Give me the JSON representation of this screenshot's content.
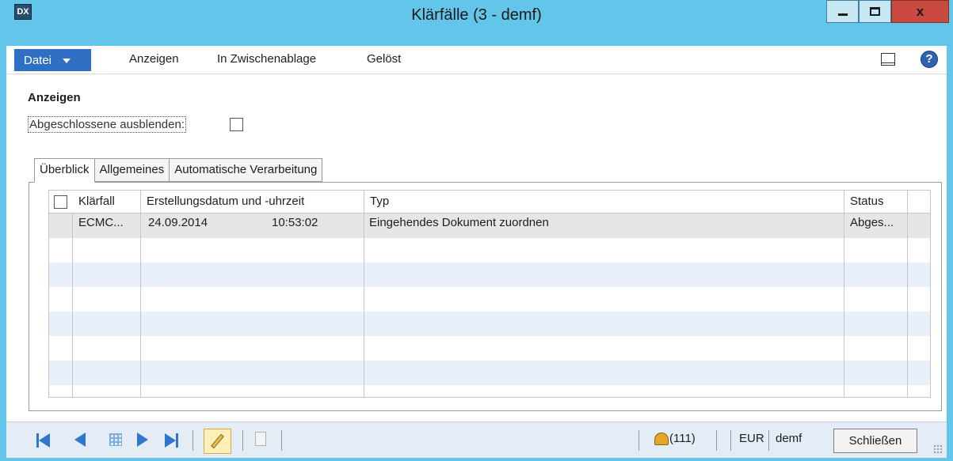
{
  "window": {
    "title": "Klärfälle (3 - demf)",
    "app_icon": "DX"
  },
  "ribbon": {
    "file_label": "Datei",
    "menu": [
      "Anzeigen",
      "In Zwischenablage",
      "Gelöst"
    ],
    "help_glyph": "?"
  },
  "filter": {
    "section_title": "Anzeigen",
    "hide_closed_label": "Abgeschlossene ausblenden:",
    "hide_closed_checked": false
  },
  "tabs": [
    "Überblick",
    "Allgemeines",
    "Automatische Verarbeitung"
  ],
  "grid": {
    "columns": [
      "Klärfall",
      "Erstellungsdatum und -uhrzeit",
      "Typ",
      "Status"
    ],
    "rows": [
      {
        "case": "ECMC...",
        "date": "24.09.2014",
        "time": "10:53:02",
        "type": "Eingehendes Dokument zuordnen",
        "status": "Abges..."
      }
    ]
  },
  "statusbar": {
    "notifications": "(111)",
    "currency": "EUR",
    "company": "demf",
    "close_label": "Schließen"
  },
  "colors": {
    "frame": "#62c5e9",
    "file_button": "#2f70c4",
    "close_window": "#c94a3f",
    "nav_blue": "#2e77cf"
  }
}
